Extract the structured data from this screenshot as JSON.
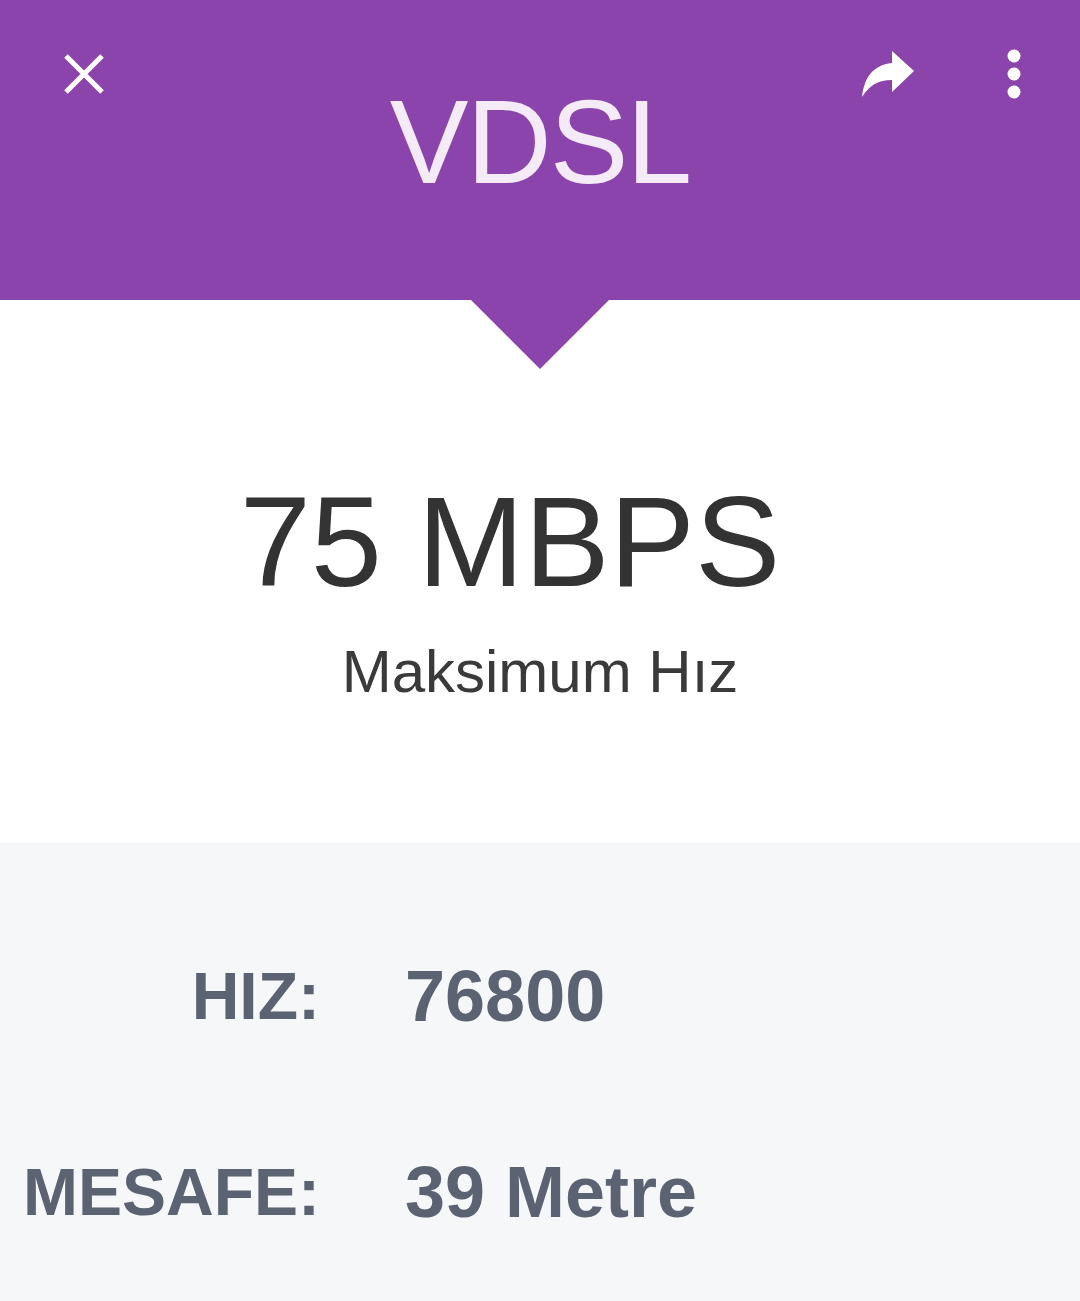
{
  "header": {
    "title": "VDSL"
  },
  "speed": {
    "value": "75 MBPS",
    "caption": "Maksimum Hız"
  },
  "details": [
    {
      "label": "HIZ:",
      "value": "76800"
    },
    {
      "label": "MESAFE:",
      "value": "39 Metre"
    }
  ]
}
